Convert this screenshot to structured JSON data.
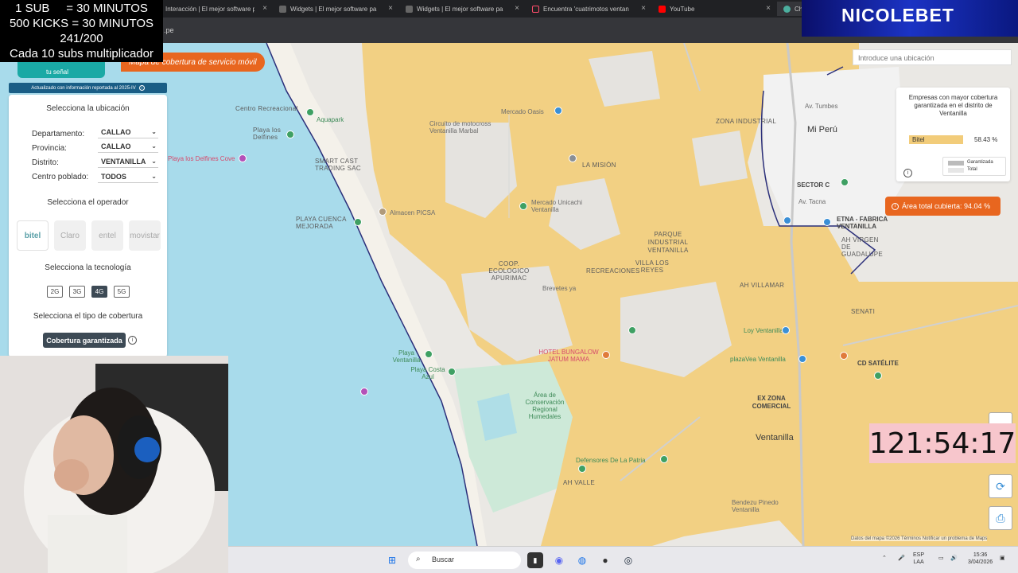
{
  "browser": {
    "tabs": [
      {
        "title": "Interacción | El mejor software pa"
      },
      {
        "title": "Widgets | El mejor software pa"
      },
      {
        "title": "Widgets | El mejor software pa"
      },
      {
        "title": "Encuentra 'cuatrimotos ventan"
      },
      {
        "title": "YouTube"
      },
      {
        "title": "Ch"
      }
    ],
    "url_fragment": ".pe"
  },
  "overlay": {
    "counter_lines": [
      "1 SUB     = 30 MINUTOS",
      "500 KICKS = 30 MINUTOS",
      "241/200",
      "Cada 10 subs multiplicador"
    ],
    "brand": "NICOLEBET",
    "timer": "121:54:17"
  },
  "app": {
    "logo_sub": "tu señal",
    "banner": "Mapa de cobertura de servicio móvil",
    "updated": "Actualizado con información reportada al 2025-IV",
    "location_title": "Selecciona la ubicación",
    "fields": [
      {
        "label": "Departamento:",
        "value": "CALLAO"
      },
      {
        "label": "Provincia:",
        "value": "CALLAO"
      },
      {
        "label": "Distrito:",
        "value": "VENTANILLA"
      },
      {
        "label": "Centro poblado:",
        "value": "TODOS"
      }
    ],
    "operator_title": "Selecciona el operador",
    "operators": [
      "bitel",
      "Claro",
      "entel",
      "movistar"
    ],
    "technology_title": "Selecciona la tecnología",
    "technologies": [
      "2G",
      "3G",
      "4G",
      "5G"
    ],
    "selected_technology": "4G",
    "coverage_title": "Selecciona el tipo de cobertura",
    "coverage_button": "Cobertura garantizada"
  },
  "map": {
    "search_placeholder": "Introduce una ubicación",
    "panel_title": "Empresas con mayor cobertura garantizada en el distrito de Ventanilla",
    "operator_name": "Bitel",
    "operator_percent": "58.43 %",
    "legend": [
      "Garantizada",
      "Total"
    ],
    "area_total": "Área total cubierta: 94.04 %",
    "attribution": "Datos del mapa ©2026   Términos   Notificar un problema de Maps",
    "labels": {
      "centro_recreacional": "Centro Recreacional",
      "playa_delfines": "Playa los Delfines",
      "delfines_cove": "Playa los Delfines Cove",
      "smart_cast": "SMART CAST TRADING SAC",
      "aquapark": "Aquapark",
      "circuito": "Circuito de motocross Ventanilla Marbal",
      "mercado_oasis": "Mercado Oasis",
      "la_mision": "LA MISIÓN",
      "playa_cuenca": "PLAYA CUENCA MEJORADA",
      "almacen": "Almacen PICSA",
      "mercado_unicachi": "Mercado Unicachi Ventanilla",
      "zona_industrial": "ZONA INDUSTRIAL",
      "mi_peru": "Mi Perú",
      "sector_c": "SECTOR C",
      "parque_industrial": "PARQUE INDUSTRIAL VENTANILLA",
      "coop_apurimac": "COOP. ECOLOGICO APURIMAC",
      "recreaciones": "RECREACIONES",
      "villa_los_reyes": "VILLA LOS REYES",
      "av_villamar": "AH VILLAMAR",
      "brevetes": "Brevetes ya",
      "fabrica": "ETNA - FABRICA VENTANILLA",
      "virgen_guadalupe": "AH VIRGEN DE GUADALUPE",
      "senati": "SENATI",
      "loy_ventanilla": "Loy Ventanilla",
      "hotel_bungalow": "HOTEL BUNGALOW JATUM MAMA",
      "playa_ventanilla": "Playa Ventanilla",
      "playa_costa_azul": "Playa Costa Azul",
      "area_conservacion": "Área de Conservación Regional Humedales",
      "plaza_ventanilla": "plazaVea Ventanilla",
      "cd_satelite": "CD SATÉLITE",
      "ex_zona_comercial": "EX ZONA COMERCIAL",
      "ventanilla": "Ventanilla",
      "defensores": "Defensores De La Patria",
      "ah_valle": "AH VALLE",
      "bendezu": "Bendezu Pinedo Ventanilla",
      "tumbes": "Av. Tumbes",
      "av_tacna": "Av. Tacna"
    }
  },
  "taskbar": {
    "search": "Buscar",
    "lang": "ESP\nLAA",
    "time": "15:36",
    "date": "3/04/2026"
  },
  "colors": {
    "coverage": "#f3cd78",
    "sea": "#a8dbeb",
    "accent": "#e8661f"
  }
}
